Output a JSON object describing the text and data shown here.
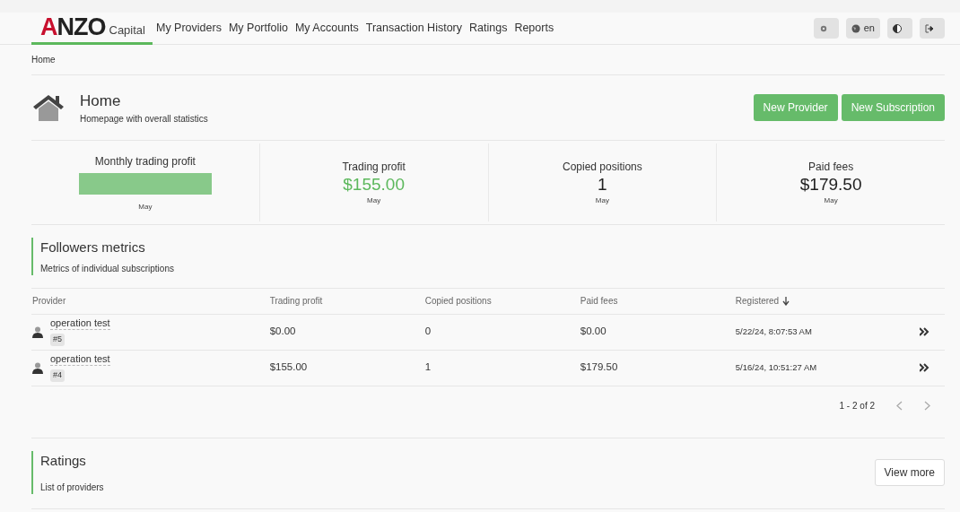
{
  "logo": {
    "text": "ANZO",
    "tagline": "Capital",
    "selected": true
  },
  "nav": [
    {
      "label": "My Providers",
      "selected": false
    },
    {
      "label": "My Portfolio",
      "selected": false
    },
    {
      "label": "My Accounts",
      "selected": false
    },
    {
      "label": "Transaction History",
      "selected": false
    },
    {
      "label": "Ratings",
      "selected": false
    },
    {
      "label": "Reports",
      "selected": false
    }
  ],
  "toolbar": [
    {
      "kind": "settings"
    },
    {
      "kind": "language",
      "label": "en"
    },
    {
      "kind": "theme"
    },
    {
      "kind": "logout"
    }
  ],
  "breadcrumb": "Home",
  "header": {
    "title": "Home",
    "subtitle": "Homepage with overall statistics",
    "buttons": [
      "New Provider",
      "New Subscription"
    ]
  },
  "stats": [
    {
      "kind": "chart",
      "label": "Monthly trading profit",
      "period": "May"
    },
    {
      "kind": "value",
      "label": "Trading profit",
      "value": "$155.00",
      "positive": true,
      "period": "May"
    },
    {
      "kind": "value",
      "label": "Copied positions",
      "value": "1",
      "positive": false,
      "period": "May"
    },
    {
      "kind": "value",
      "label": "Paid fees",
      "value": "$179.50",
      "positive": false,
      "period": "May"
    }
  ],
  "followers": {
    "title": "Followers metrics",
    "subtitle": "Metrics of individual subscriptions",
    "columns": [
      {
        "label": "Provider",
        "sorted": false
      },
      {
        "label": "Trading profit",
        "sorted": false
      },
      {
        "label": "Copied positions",
        "sorted": false
      },
      {
        "label": "Paid fees",
        "sorted": false
      },
      {
        "label": "Registered",
        "sorted": true
      }
    ],
    "rows": [
      {
        "provider": "operation test",
        "id": "#5",
        "profit": "$0.00",
        "positions": "0",
        "fees": "$0.00",
        "registered": "5/22/24, 8:07:53 AM"
      },
      {
        "provider": "operation test",
        "id": "#4",
        "profit": "$155.00",
        "positions": "1",
        "fees": "$179.50",
        "registered": "5/16/24, 10:51:27 AM"
      }
    ],
    "pagination": "1 - 2 of 2"
  },
  "ratings": {
    "title": "Ratings",
    "subtitle": "List of providers",
    "button": "View more"
  }
}
